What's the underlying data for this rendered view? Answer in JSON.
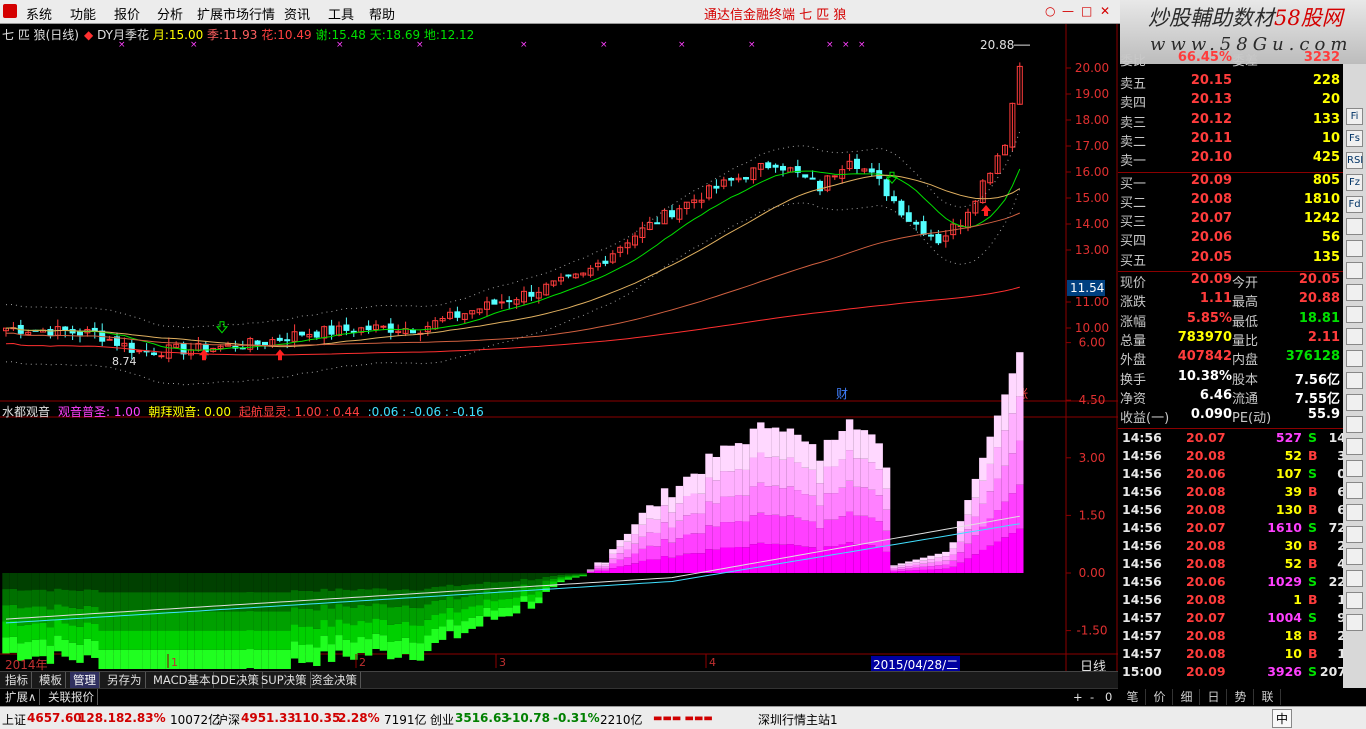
{
  "menubar": {
    "items": [
      "系统",
      "功能",
      "报价",
      "分析",
      "扩展市场行情",
      "资讯",
      "工具",
      "帮助"
    ],
    "app_title": "通达信金融终端  七 匹 狼",
    "window_buttons": [
      "○",
      "—",
      "□",
      "✕"
    ]
  },
  "brand": {
    "text_a": "炒股輔助数材",
    "text_b": "58股网",
    "domain": "www.58Gu.com"
  },
  "main_chart": {
    "title": "七 匹 狼(日线)",
    "indicator_name": "DY月季花",
    "params": [
      {
        "label": "月:",
        "value": "15.00",
        "color": "#ffff00"
      },
      {
        "label": "季:",
        "value": "11.93",
        "color": "#ff6060"
      },
      {
        "label": "花:",
        "value": "10.49",
        "color": "#ff4040"
      },
      {
        "label": "谢:",
        "value": "15.48",
        "color": "#00e000"
      },
      {
        "label": "天:",
        "value": "18.69",
        "color": "#00e000"
      },
      {
        "label": "地:",
        "value": "12.12",
        "color": "#00e000"
      }
    ],
    "high_label": "20.88",
    "low_label": "8.74",
    "current_price_tag": "11.54",
    "marker_cai": "财",
    "marker_zhang": "涨",
    "price_axis": [
      {
        "v": 20.0,
        "label": "20.00"
      },
      {
        "v": 19.0,
        "label": "19.00"
      },
      {
        "v": 18.0,
        "label": "18.00"
      },
      {
        "v": 17.0,
        "label": "17.00"
      },
      {
        "v": 16.0,
        "label": "16.00"
      },
      {
        "v": 15.0,
        "label": "15.00"
      },
      {
        "v": 14.0,
        "label": "14.00"
      },
      {
        "v": 13.0,
        "label": "13.00"
      },
      {
        "v": 11.0,
        "label": "11.00"
      },
      {
        "v": 10.0,
        "label": "10.00"
      }
    ]
  },
  "sub_chart": {
    "name": "水都观音",
    "params": [
      {
        "label": "观音普圣:",
        "value": "1.00",
        "color": "#ff40ff"
      },
      {
        "label": "朝拜观音:",
        "value": "0.00",
        "color": "#ffff00"
      },
      {
        "label": "起航显灵:",
        "value": "1.00 : 0.44",
        "color": "#ff4040"
      },
      {
        "label": "",
        "value": ":0.06 : -0.06 : -0.16",
        "color": "#40e0ff"
      }
    ],
    "axis": [
      {
        "v": 6.0,
        "label": "6.00"
      },
      {
        "v": 4.5,
        "label": "4.50"
      },
      {
        "v": 3.0,
        "label": "3.00"
      },
      {
        "v": 1.5,
        "label": "1.50"
      },
      {
        "v": 0.0,
        "label": "0.00"
      },
      {
        "v": -1.5,
        "label": "-1.50"
      }
    ]
  },
  "date_axis": {
    "year_label": "2014年",
    "months": [
      "1",
      "2",
      "3",
      "4"
    ],
    "cursor_date": "2015/04/28/二",
    "period": "日线",
    "zoom_buttons": [
      "+",
      "-",
      "0"
    ]
  },
  "tabs": [
    "指标",
    "模板",
    "管理",
    "另存为",
    "MACD基本",
    "DDE决策",
    "SUP决策",
    "资金决策"
  ],
  "tabs_row2": [
    "扩展∧",
    "关联报价"
  ],
  "quote_panel": {
    "weibi": {
      "label": "委比",
      "value": "66.45%",
      "label2": "委差",
      "value2": "3232"
    },
    "asks": [
      {
        "label": "卖五",
        "price": "20.15",
        "vol": "228"
      },
      {
        "label": "卖四",
        "price": "20.13",
        "vol": "20"
      },
      {
        "label": "卖三",
        "price": "20.12",
        "vol": "133"
      },
      {
        "label": "卖二",
        "price": "20.11",
        "vol": "10"
      },
      {
        "label": "卖一",
        "price": "20.10",
        "vol": "425"
      }
    ],
    "bids": [
      {
        "label": "买一",
        "price": "20.09",
        "vol": "805"
      },
      {
        "label": "买二",
        "price": "20.08",
        "vol": "1810"
      },
      {
        "label": "买三",
        "price": "20.07",
        "vol": "1242"
      },
      {
        "label": "买四",
        "price": "20.06",
        "vol": "56"
      },
      {
        "label": "买五",
        "price": "20.05",
        "vol": "135"
      }
    ],
    "stats": [
      {
        "l1": "现价",
        "v1": "20.09",
        "c1": "#ff3c3c",
        "l2": "今开",
        "v2": "20.05",
        "c2": "#ff3c3c"
      },
      {
        "l1": "涨跌",
        "v1": "1.11",
        "c1": "#ff3c3c",
        "l2": "最高",
        "v2": "20.88",
        "c2": "#ff3c3c"
      },
      {
        "l1": "涨幅",
        "v1": "5.85%",
        "c1": "#ff3c3c",
        "l2": "最低",
        "v2": "18.81",
        "c2": "#00e000"
      },
      {
        "l1": "总量",
        "v1": "783970",
        "c1": "#ffff00",
        "l2": "量比",
        "v2": "2.11",
        "c2": "#ff3c3c"
      },
      {
        "l1": "外盘",
        "v1": "407842",
        "c1": "#ff3c3c",
        "l2": "内盘",
        "v2": "376128",
        "c2": "#00e000"
      },
      {
        "l1": "换手",
        "v1": "10.38%",
        "c1": "#ffffff",
        "l2": "股本",
        "v2": "7.56亿",
        "c2": "#ffffff"
      },
      {
        "l1": "净资",
        "v1": "6.46",
        "c1": "#ffffff",
        "l2": "流通",
        "v2": "7.55亿",
        "c2": "#ffffff"
      },
      {
        "l1": "收益(一)",
        "v1": "0.090",
        "c1": "#ffffff",
        "l2": "PE(动)",
        "v2": "55.9",
        "c2": "#ffffff"
      }
    ],
    "ticks": [
      {
        "t": "14:56",
        "p": "20.07",
        "v": "527",
        "f": "S",
        "n": "14"
      },
      {
        "t": "14:56",
        "p": "20.08",
        "v": "52",
        "f": "B",
        "n": "3"
      },
      {
        "t": "14:56",
        "p": "20.06",
        "v": "107",
        "f": "S",
        "n": "0"
      },
      {
        "t": "14:56",
        "p": "20.08",
        "v": "39",
        "f": "B",
        "n": "6"
      },
      {
        "t": "14:56",
        "p": "20.08",
        "v": "130",
        "f": "B",
        "n": "6"
      },
      {
        "t": "14:56",
        "p": "20.07",
        "v": "1610",
        "f": "S",
        "n": "72"
      },
      {
        "t": "14:56",
        "p": "20.08",
        "v": "30",
        "f": "B",
        "n": "2"
      },
      {
        "t": "14:56",
        "p": "20.08",
        "v": "52",
        "f": "B",
        "n": "4"
      },
      {
        "t": "14:56",
        "p": "20.06",
        "v": "1029",
        "f": "S",
        "n": "22"
      },
      {
        "t": "14:56",
        "p": "20.08",
        "v": "1",
        "f": "B",
        "n": "1"
      },
      {
        "t": "14:57",
        "p": "20.07",
        "v": "1004",
        "f": "S",
        "n": "9"
      },
      {
        "t": "14:57",
        "p": "20.08",
        "v": "18",
        "f": "B",
        "n": "2"
      },
      {
        "t": "14:57",
        "p": "20.08",
        "v": "10",
        "f": "B",
        "n": "1"
      },
      {
        "t": "15:00",
        "p": "20.09",
        "v": "3926",
        "f": "S",
        "n": "207"
      }
    ]
  },
  "right_tabs": [
    "笔",
    "价",
    "细",
    "日",
    "势",
    "联"
  ],
  "status": {
    "sh_label": "上证",
    "sh_val": "4657.60",
    "sh_chg": "128.18",
    "sh_pct": "2.83%",
    "sh_amt": "10072亿",
    "hs_label": "沪深",
    "hs_val": "4951.33",
    "hs_chg": "110.35",
    "hs_pct": "2.28%",
    "hs_amt": "7191亿",
    "cy_label": "创业",
    "cy_val": "3516.63",
    "cy_chg": "-10.78",
    "cy_pct": "-0.31%",
    "cy_amt": "2210亿",
    "server": "深圳行情主站1",
    "ime": "中",
    "blink": "▬▬▬ ▬▬▬"
  },
  "sidebar_icons": [
    "Fi",
    "Fs",
    "RSI",
    "Fz",
    "Fd"
  ],
  "colors": {
    "up": "#ff3c3c",
    "down": "#54ffff",
    "ma_green": "#00e000",
    "ma_yellow": "#e0b060",
    "ma_red": "#ff3030",
    "grid_red": "#8b0000"
  }
}
